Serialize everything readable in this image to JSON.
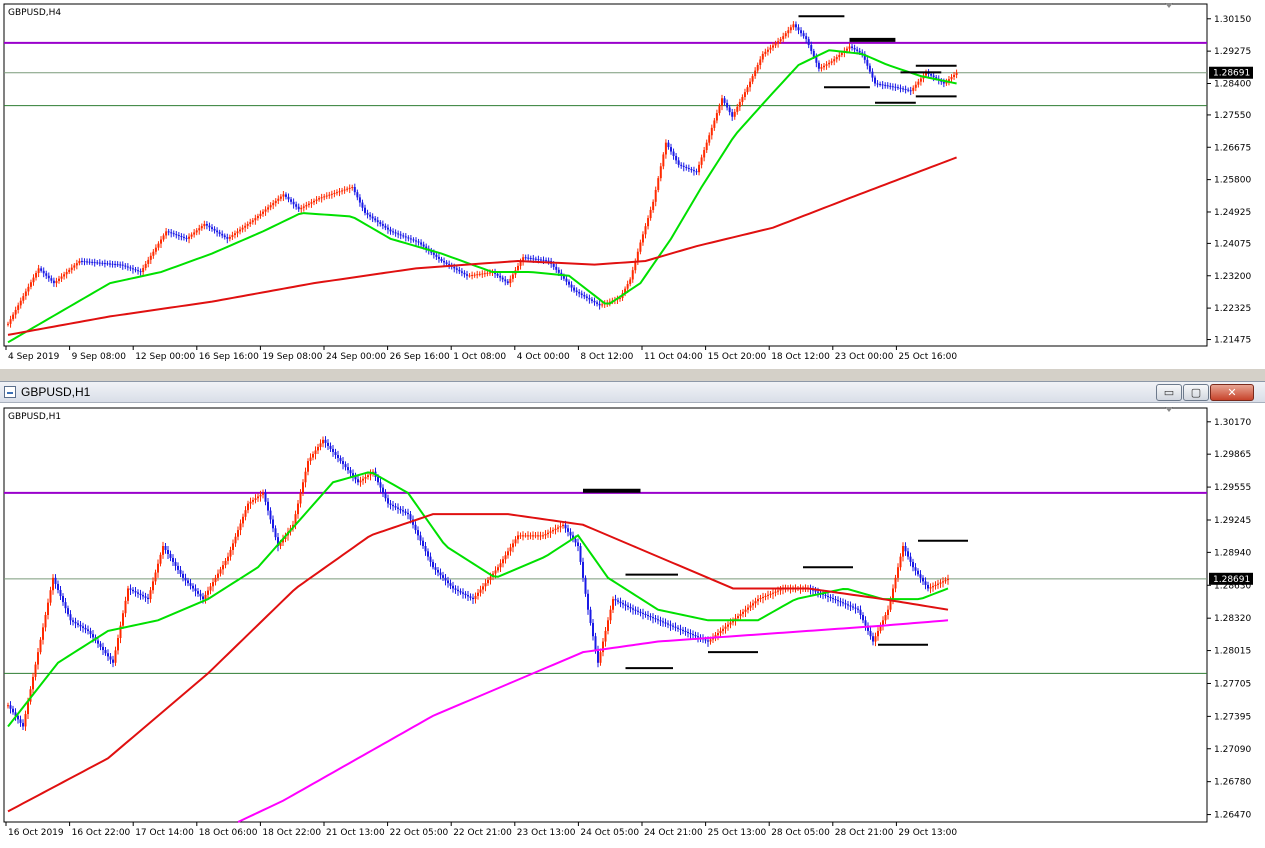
{
  "window": {
    "title": "GBPUSD,H1",
    "min_symbol": "▭",
    "max_symbol": "▢",
    "close_symbol": "✕"
  },
  "colors": {
    "bull": "#ff2a00",
    "bear": "#1a1ae6",
    "ma_fast": "#00e000",
    "ma_slow": "#e01010",
    "ma_long": "#ff00ff",
    "hline_purple": "#9900cc",
    "hline_green": "#2e7d32",
    "hline_gray": "#7a9a7a",
    "bid_badge_bg": "#000000",
    "annotation": "#000000"
  },
  "chart_data": [
    {
      "type": "candlestick",
      "title": "GBPUSD,H4",
      "ylim": [
        1.213,
        1.3055
      ],
      "y_ticks": [
        "1.30150",
        "1.29275",
        "1.28400",
        "1.27550",
        "1.26675",
        "1.25800",
        "1.24925",
        "1.24075",
        "1.23200",
        "1.22325",
        "1.21475"
      ],
      "x_ticks": [
        "4 Sep 2019",
        "9 Sep 08:00",
        "12 Sep 00:00",
        "16 Sep 16:00",
        "19 Sep 08:00",
        "24 Sep 00:00",
        "26 Sep 16:00",
        "1 Oct 08:00",
        "4 Oct 00:00",
        "8 Oct 12:00",
        "11 Oct 04:00",
        "15 Oct 20:00",
        "18 Oct 12:00",
        "23 Oct 00:00",
        "25 Oct 16:00"
      ],
      "current_price": "1.28691",
      "h_lines": [
        {
          "value": 1.295,
          "color": "purple"
        },
        {
          "value": 1.2869,
          "color": "gray"
        },
        {
          "value": 1.278,
          "color": "green"
        }
      ],
      "close_path": [
        [
          0,
          1.219
        ],
        [
          12,
          1.234
        ],
        [
          18,
          1.23
        ],
        [
          28,
          1.236
        ],
        [
          44,
          1.235
        ],
        [
          52,
          1.233
        ],
        [
          62,
          1.244
        ],
        [
          70,
          1.242
        ],
        [
          77,
          1.246
        ],
        [
          86,
          1.242
        ],
        [
          96,
          1.247
        ],
        [
          108,
          1.254
        ],
        [
          114,
          1.25
        ],
        [
          122,
          1.253
        ],
        [
          135,
          1.256
        ],
        [
          140,
          1.249
        ],
        [
          150,
          1.244
        ],
        [
          161,
          1.241
        ],
        [
          170,
          1.236
        ],
        [
          180,
          1.232
        ],
        [
          190,
          1.233
        ],
        [
          196,
          1.23
        ],
        [
          202,
          1.237
        ],
        [
          212,
          1.236
        ],
        [
          222,
          1.228
        ],
        [
          232,
          1.224
        ],
        [
          240,
          1.226
        ],
        [
          244,
          1.231
        ],
        [
          248,
          1.241
        ],
        [
          253,
          1.252
        ],
        [
          258,
          1.268
        ],
        [
          263,
          1.262
        ],
        [
          270,
          1.26
        ],
        [
          276,
          1.272
        ],
        [
          280,
          1.28
        ],
        [
          284,
          1.275
        ],
        [
          290,
          1.283
        ],
        [
          296,
          1.292
        ],
        [
          303,
          1.296
        ],
        [
          308,
          1.3
        ],
        [
          313,
          1.296
        ],
        [
          318,
          1.288
        ],
        [
          323,
          1.29
        ],
        [
          330,
          1.294
        ],
        [
          335,
          1.292
        ],
        [
          340,
          1.284
        ],
        [
          348,
          1.283
        ],
        [
          354,
          1.282
        ],
        [
          360,
          1.287
        ],
        [
          367,
          1.284
        ],
        [
          372,
          1.2869
        ]
      ],
      "series": [
        {
          "name": "MA fast",
          "color_key": "ma_fast",
          "values": [
            [
              0,
              1.214
            ],
            [
              20,
              1.222
            ],
            [
              40,
              1.23
            ],
            [
              60,
              1.233
            ],
            [
              80,
              1.238
            ],
            [
              100,
              1.244
            ],
            [
              115,
              1.249
            ],
            [
              135,
              1.248
            ],
            [
              150,
              1.242
            ],
            [
              170,
              1.238
            ],
            [
              190,
              1.233
            ],
            [
              205,
              1.233
            ],
            [
              220,
              1.232
            ],
            [
              235,
              1.224
            ],
            [
              248,
              1.23
            ],
            [
              260,
              1.242
            ],
            [
              272,
              1.256
            ],
            [
              285,
              1.27
            ],
            [
              298,
              1.28
            ],
            [
              310,
              1.289
            ],
            [
              322,
              1.293
            ],
            [
              335,
              1.292
            ],
            [
              345,
              1.289
            ],
            [
              358,
              1.286
            ],
            [
              372,
              1.284
            ]
          ]
        },
        {
          "name": "MA slow",
          "color_key": "ma_slow",
          "values": [
            [
              0,
              1.216
            ],
            [
              40,
              1.221
            ],
            [
              80,
              1.225
            ],
            [
              120,
              1.23
            ],
            [
              160,
              1.234
            ],
            [
              200,
              1.236
            ],
            [
              230,
              1.235
            ],
            [
              250,
              1.236
            ],
            [
              270,
              1.24
            ],
            [
              300,
              1.245
            ],
            [
              330,
              1.253
            ],
            [
              372,
              1.264
            ]
          ]
        }
      ]
    },
    {
      "type": "candlestick",
      "title": "GBPUSD,H1",
      "ylim": [
        1.264,
        1.303
      ],
      "y_ticks": [
        "1.30170",
        "1.29865",
        "1.29555",
        "1.29245",
        "1.28940",
        "1.28630",
        "1.28320",
        "1.28015",
        "1.27705",
        "1.27395",
        "1.27090",
        "1.26780",
        "1.26470"
      ],
      "x_ticks": [
        "16 Oct 2019",
        "16 Oct 22:00",
        "17 Oct 14:00",
        "18 Oct 06:00",
        "18 Oct 22:00",
        "21 Oct 13:00",
        "22 Oct 05:00",
        "22 Oct 21:00",
        "23 Oct 13:00",
        "24 Oct 05:00",
        "24 Oct 21:00",
        "25 Oct 13:00",
        "28 Oct 05:00",
        "28 Oct 21:00",
        "29 Oct 13:00"
      ],
      "current_price": "1.28691",
      "h_lines": [
        {
          "value": 1.295,
          "color": "purple"
        },
        {
          "value": 1.2869,
          "color": "gray"
        },
        {
          "value": 1.278,
          "color": "green"
        }
      ],
      "close_path": [
        [
          0,
          1.275
        ],
        [
          6,
          1.273
        ],
        [
          12,
          1.28
        ],
        [
          18,
          1.287
        ],
        [
          25,
          1.283
        ],
        [
          32,
          1.282
        ],
        [
          42,
          1.279
        ],
        [
          48,
          1.286
        ],
        [
          56,
          1.285
        ],
        [
          62,
          1.29
        ],
        [
          70,
          1.287
        ],
        [
          78,
          1.285
        ],
        [
          88,
          1.289
        ],
        [
          96,
          1.294
        ],
        [
          102,
          1.295
        ],
        [
          108,
          1.29
        ],
        [
          114,
          1.292
        ],
        [
          120,
          1.298
        ],
        [
          126,
          1.3
        ],
        [
          133,
          1.298
        ],
        [
          140,
          1.296
        ],
        [
          146,
          1.297
        ],
        [
          152,
          1.294
        ],
        [
          160,
          1.293
        ],
        [
          170,
          1.288
        ],
        [
          178,
          1.286
        ],
        [
          186,
          1.285
        ],
        [
          196,
          1.288
        ],
        [
          204,
          1.291
        ],
        [
          214,
          1.291
        ],
        [
          222,
          1.292
        ],
        [
          228,
          1.29
        ],
        [
          232,
          1.284
        ],
        [
          236,
          1.279
        ],
        [
          242,
          1.285
        ],
        [
          250,
          1.284
        ],
        [
          260,
          1.283
        ],
        [
          270,
          1.282
        ],
        [
          280,
          1.281
        ],
        [
          290,
          1.283
        ],
        [
          300,
          1.285
        ],
        [
          310,
          1.286
        ],
        [
          320,
          1.286
        ],
        [
          330,
          1.285
        ],
        [
          340,
          1.284
        ],
        [
          346,
          1.281
        ],
        [
          352,
          1.284
        ],
        [
          358,
          1.29
        ],
        [
          362,
          1.288
        ],
        [
          368,
          1.286
        ],
        [
          376,
          1.2869
        ]
      ],
      "series": [
        {
          "name": "MA fast",
          "color_key": "ma_fast",
          "values": [
            [
              0,
              1.273
            ],
            [
              20,
              1.279
            ],
            [
              40,
              1.282
            ],
            [
              60,
              1.283
            ],
            [
              80,
              1.285
            ],
            [
              100,
              1.288
            ],
            [
              115,
              1.292
            ],
            [
              130,
              1.296
            ],
            [
              145,
              1.297
            ],
            [
              160,
              1.295
            ],
            [
              175,
              1.29
            ],
            [
              195,
              1.287
            ],
            [
              215,
              1.289
            ],
            [
              228,
              1.291
            ],
            [
              240,
              1.287
            ],
            [
              260,
              1.284
            ],
            [
              280,
              1.283
            ],
            [
              300,
              1.283
            ],
            [
              315,
              1.285
            ],
            [
              335,
              1.286
            ],
            [
              350,
              1.285
            ],
            [
              365,
              1.285
            ],
            [
              376,
              1.286
            ]
          ]
        },
        {
          "name": "MA slow",
          "color_key": "ma_slow",
          "values": [
            [
              0,
              1.265
            ],
            [
              40,
              1.27
            ],
            [
              80,
              1.278
            ],
            [
              115,
              1.286
            ],
            [
              145,
              1.291
            ],
            [
              170,
              1.293
            ],
            [
              200,
              1.293
            ],
            [
              230,
              1.292
            ],
            [
              260,
              1.289
            ],
            [
              290,
              1.286
            ],
            [
              320,
              1.286
            ],
            [
              350,
              1.285
            ],
            [
              376,
              1.284
            ]
          ]
        },
        {
          "name": "MA long",
          "color_key": "ma_long",
          "values": [
            [
              92,
              1.264
            ],
            [
              110,
              1.266
            ],
            [
              140,
              1.27
            ],
            [
              170,
              1.274
            ],
            [
              200,
              1.277
            ],
            [
              230,
              1.28
            ],
            [
              260,
              1.281
            ],
            [
              290,
              1.2815
            ],
            [
              320,
              1.282
            ],
            [
              350,
              1.2825
            ],
            [
              376,
              1.283
            ]
          ]
        }
      ]
    }
  ]
}
